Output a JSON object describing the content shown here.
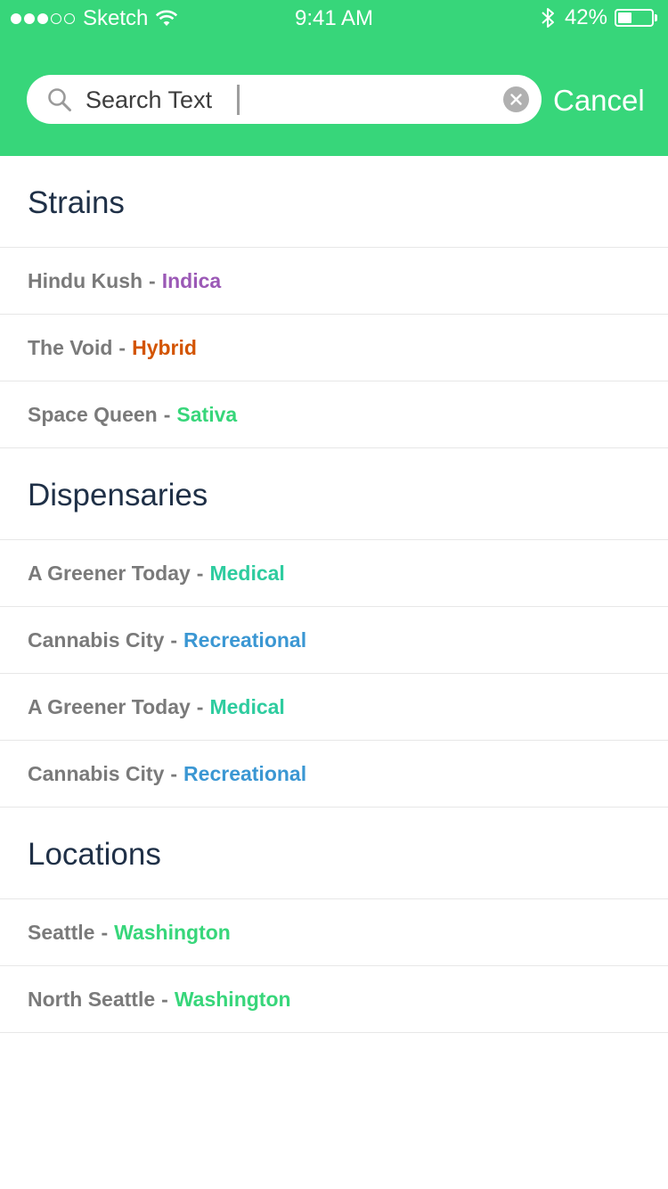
{
  "status_bar": {
    "signal_bars": 3,
    "signal_total": 5,
    "carrier": "Sketch",
    "time": "9:41 AM",
    "battery_text": "42%",
    "battery_level": 0.42,
    "wifi_icon": "wifi-icon",
    "bluetooth_icon": "bluetooth-icon"
  },
  "search": {
    "value": "Search Text",
    "search_icon": "search-icon",
    "clear_icon": "clear-icon",
    "cancel_label": "Cancel"
  },
  "colors": {
    "header_bg": "#37d67a",
    "section_title": "#1f3047",
    "item_name": "#7a7a7a",
    "indica": "#9b59b6",
    "hybrid": "#d35400",
    "sativa": "#37d67a",
    "medical": "#2ecc9f",
    "recreational": "#3b97d3",
    "washington": "#37d67a"
  },
  "sections": [
    {
      "title": "Strains",
      "items": [
        {
          "name": "Hindu Kush",
          "separator": "-",
          "tag": "Indica",
          "tag_color": "#9b59b6"
        },
        {
          "name": "The Void",
          "separator": "-",
          "tag": "Hybrid",
          "tag_color": "#d35400"
        },
        {
          "name": "Space Queen",
          "separator": "-",
          "tag": "Sativa",
          "tag_color": "#37d67a"
        }
      ]
    },
    {
      "title": "Dispensaries",
      "items": [
        {
          "name": "A Greener Today",
          "separator": "-",
          "tag": "Medical",
          "tag_color": "#2ecc9f"
        },
        {
          "name": "Cannabis City",
          "separator": "-",
          "tag": "Recreational",
          "tag_color": "#3b97d3"
        },
        {
          "name": "A Greener Today",
          "separator": "-",
          "tag": "Medical",
          "tag_color": "#2ecc9f"
        },
        {
          "name": "Cannabis City",
          "separator": "-",
          "tag": "Recreational",
          "tag_color": "#3b97d3"
        }
      ]
    },
    {
      "title": "Locations",
      "items": [
        {
          "name": "Seattle",
          "separator": "-",
          "tag": "Washington",
          "tag_color": "#37d67a"
        },
        {
          "name": "North Seattle",
          "separator": "-",
          "tag": "Washington",
          "tag_color": "#37d67a"
        }
      ]
    }
  ]
}
